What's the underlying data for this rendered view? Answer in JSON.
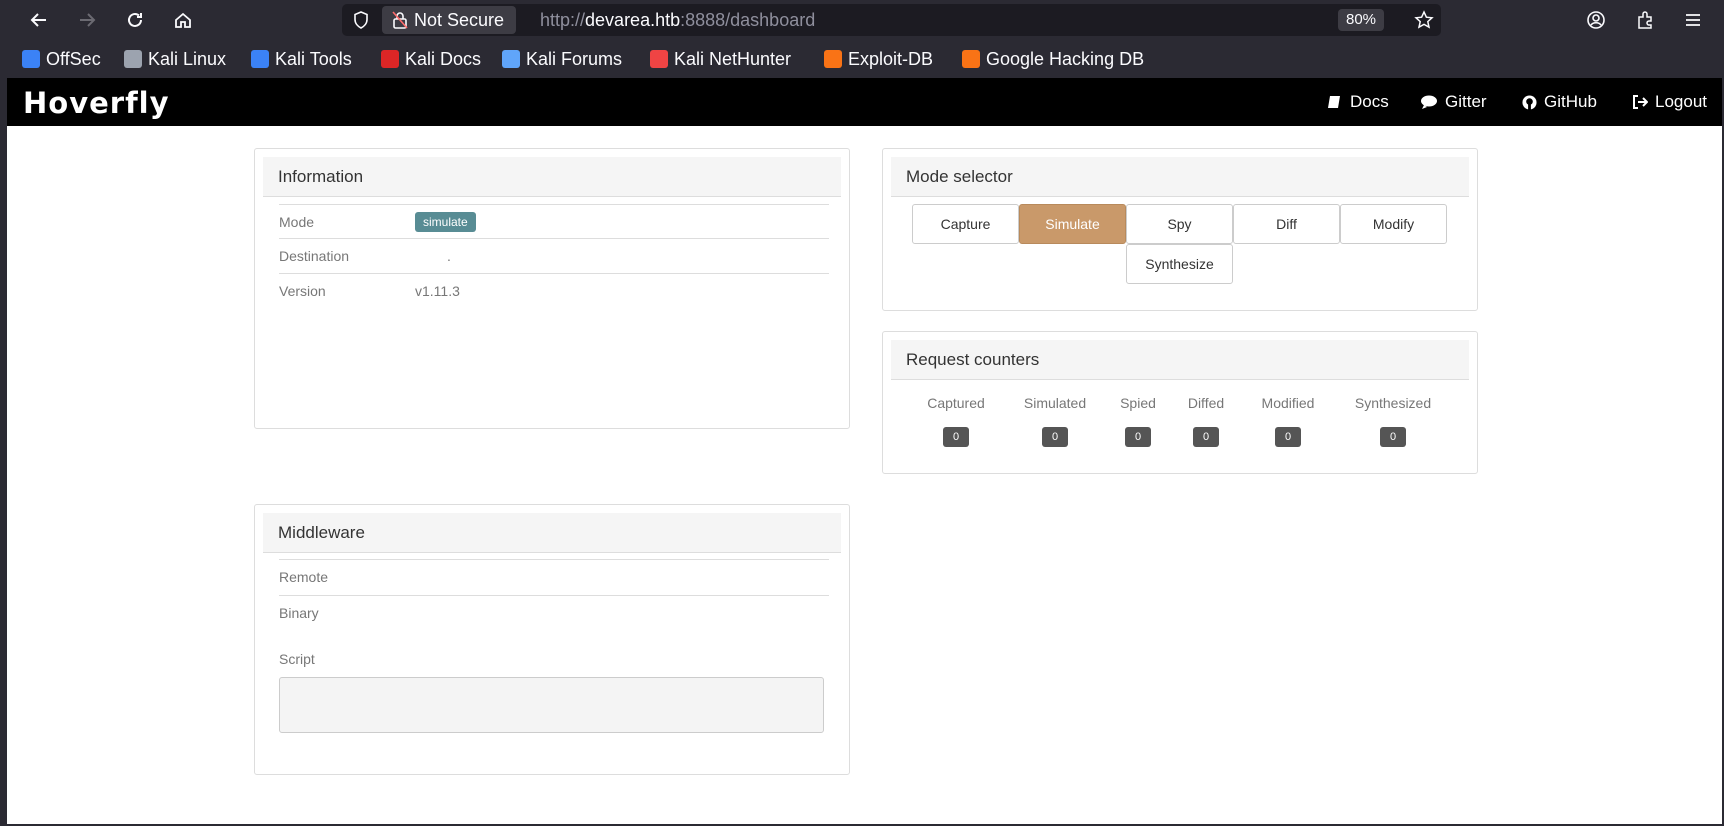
{
  "browser": {
    "not_secure_label": "Not Secure",
    "url_scheme": "http://",
    "url_host": "devarea.htb",
    "url_rest": ":8888/dashboard",
    "zoom": "80%",
    "bookmarks": [
      {
        "label": "OffSec",
        "color": "#3b82f6"
      },
      {
        "label": "Kali Linux",
        "color": "#9ca3af"
      },
      {
        "label": "Kali Tools",
        "color": "#3b82f6"
      },
      {
        "label": "Kali Docs",
        "color": "#dc2626"
      },
      {
        "label": "Kali Forums",
        "color": "#60a5fa"
      },
      {
        "label": "Kali NetHunter",
        "color": "#ef4444"
      },
      {
        "label": "Exploit-DB",
        "color": "#f97316"
      },
      {
        "label": "Google Hacking DB",
        "color": "#f97316"
      }
    ]
  },
  "app": {
    "brand": "Hoverfly",
    "nav": {
      "docs": "Docs",
      "gitter": "Gitter",
      "github": "GitHub",
      "logout": "Logout"
    }
  },
  "information": {
    "title": "Information",
    "mode_label": "Mode",
    "mode_value": "simulate",
    "destination_label": "Destination",
    "destination_value": ".",
    "version_label": "Version",
    "version_value": "v1.11.3"
  },
  "mode_selector": {
    "title": "Mode selector",
    "buttons": [
      "Capture",
      "Simulate",
      "Spy",
      "Diff",
      "Modify",
      "Synthesize"
    ],
    "active": "Simulate",
    "accent_color": "#c9996a"
  },
  "request_counters": {
    "title": "Request counters",
    "labels": [
      "Captured",
      "Simulated",
      "Spied",
      "Diffed",
      "Modified",
      "Synthesized"
    ],
    "values": [
      "0",
      "0",
      "0",
      "0",
      "0",
      "0"
    ]
  },
  "middleware": {
    "title": "Middleware",
    "remote_label": "Remote",
    "binary_label": "Binary",
    "script_label": "Script"
  }
}
